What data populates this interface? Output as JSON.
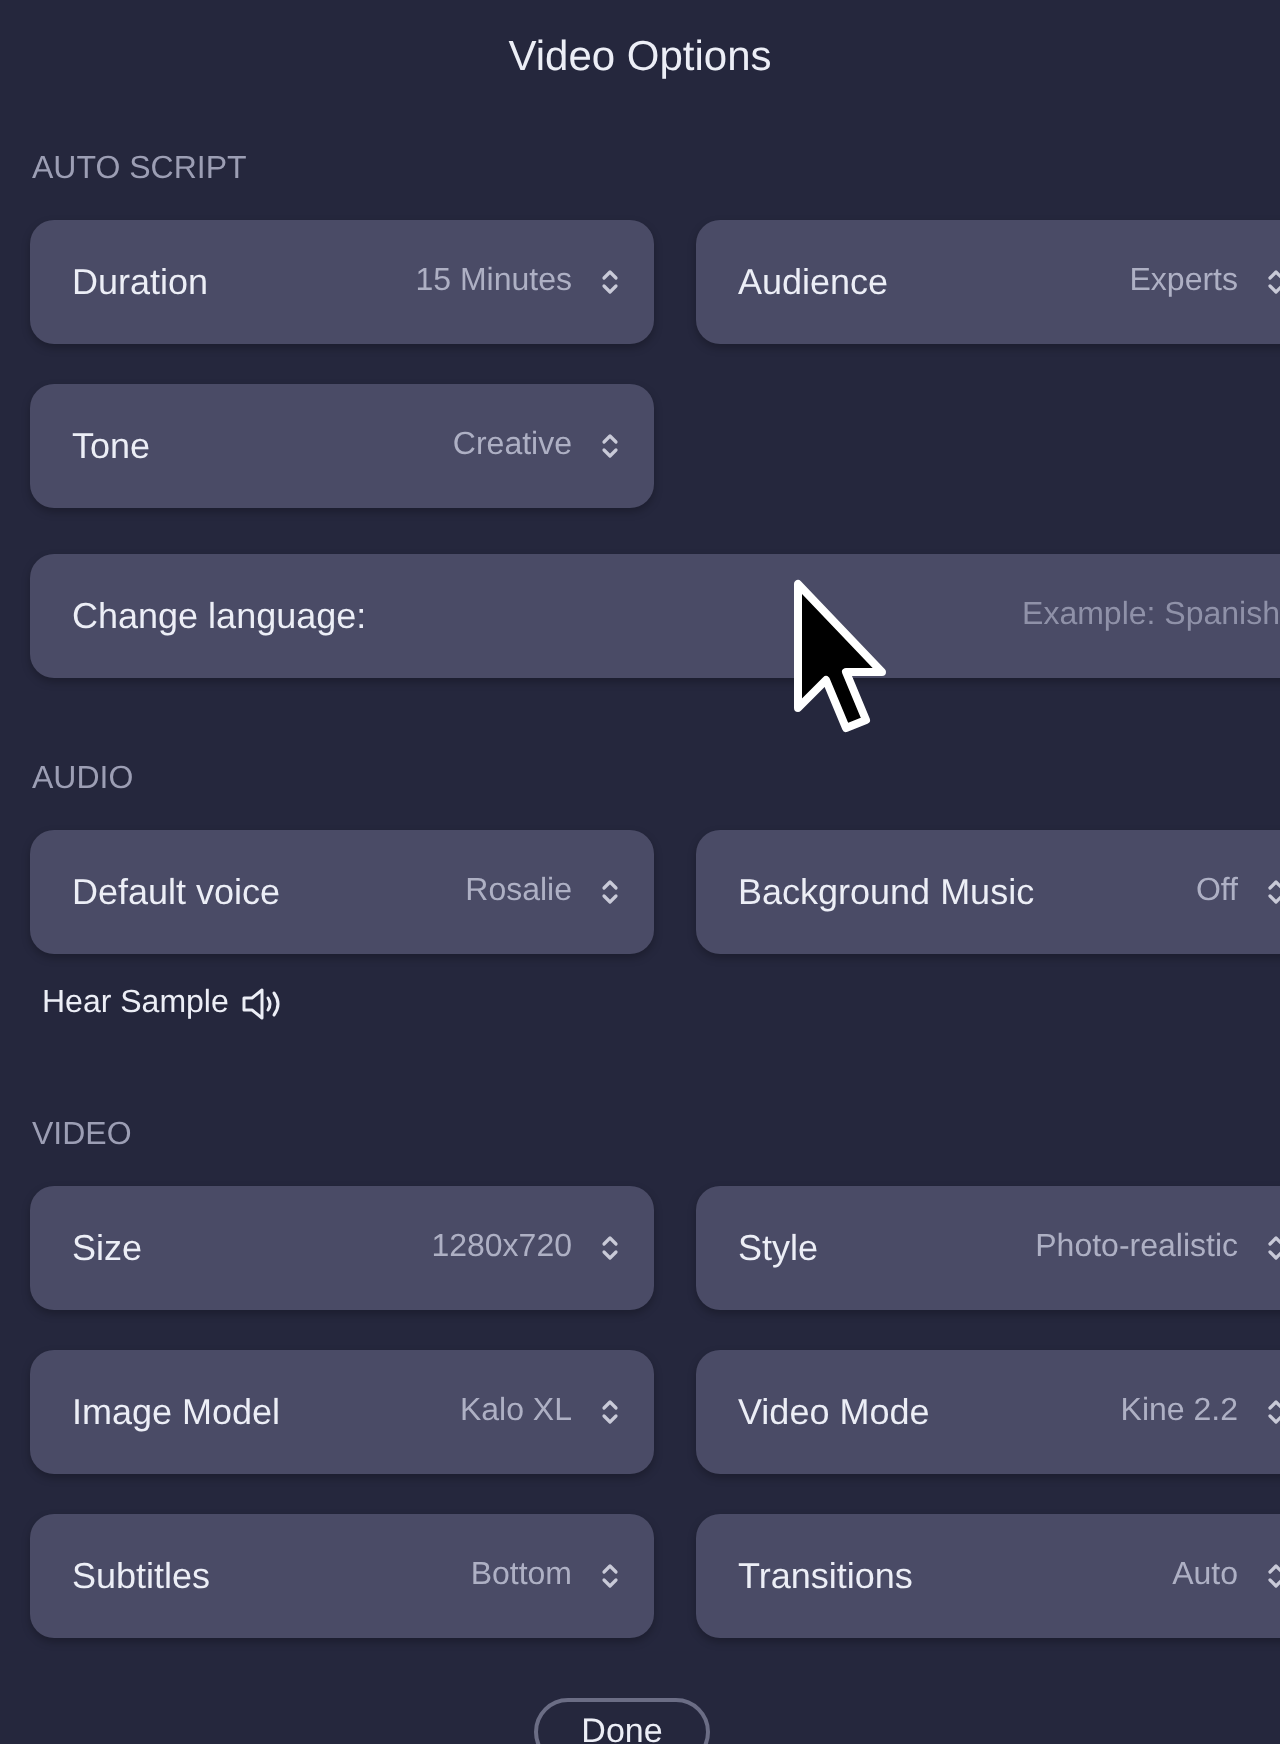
{
  "title": "Video Options",
  "sections": [
    {
      "title": "AUTO SCRIPT",
      "items": [
        {
          "kind": "select",
          "label": "Duration",
          "value": "15 Minutes"
        },
        {
          "kind": "select",
          "label": "Audience",
          "value": "Experts"
        },
        {
          "kind": "select",
          "label": "Tone",
          "value": "Creative"
        },
        {
          "kind": "spacer"
        },
        {
          "kind": "text_input",
          "label": "Change language:",
          "placeholder": "Example: Spanish"
        }
      ]
    },
    {
      "title": "AUDIO",
      "items": [
        {
          "kind": "select",
          "label": "Default voice",
          "value": "Rosalie"
        },
        {
          "kind": "select",
          "label": "Background Music",
          "value": "Off"
        },
        {
          "kind": "sample_link",
          "label": "Hear Sample"
        }
      ]
    },
    {
      "title": "VIDEO",
      "items": [
        {
          "kind": "select",
          "label": "Size",
          "value": "1280x720"
        },
        {
          "kind": "select",
          "label": "Style",
          "value": "Photo-realistic"
        },
        {
          "kind": "select",
          "label": "Image Model",
          "value": "Kalo XL"
        },
        {
          "kind": "select",
          "label": "Video Mode",
          "value": "Kine 2.2"
        },
        {
          "kind": "select",
          "label": "Subtitles",
          "value": "Bottom"
        },
        {
          "kind": "select",
          "label": "Transitions",
          "value": "Auto"
        }
      ]
    }
  ],
  "done_button": "Done"
}
